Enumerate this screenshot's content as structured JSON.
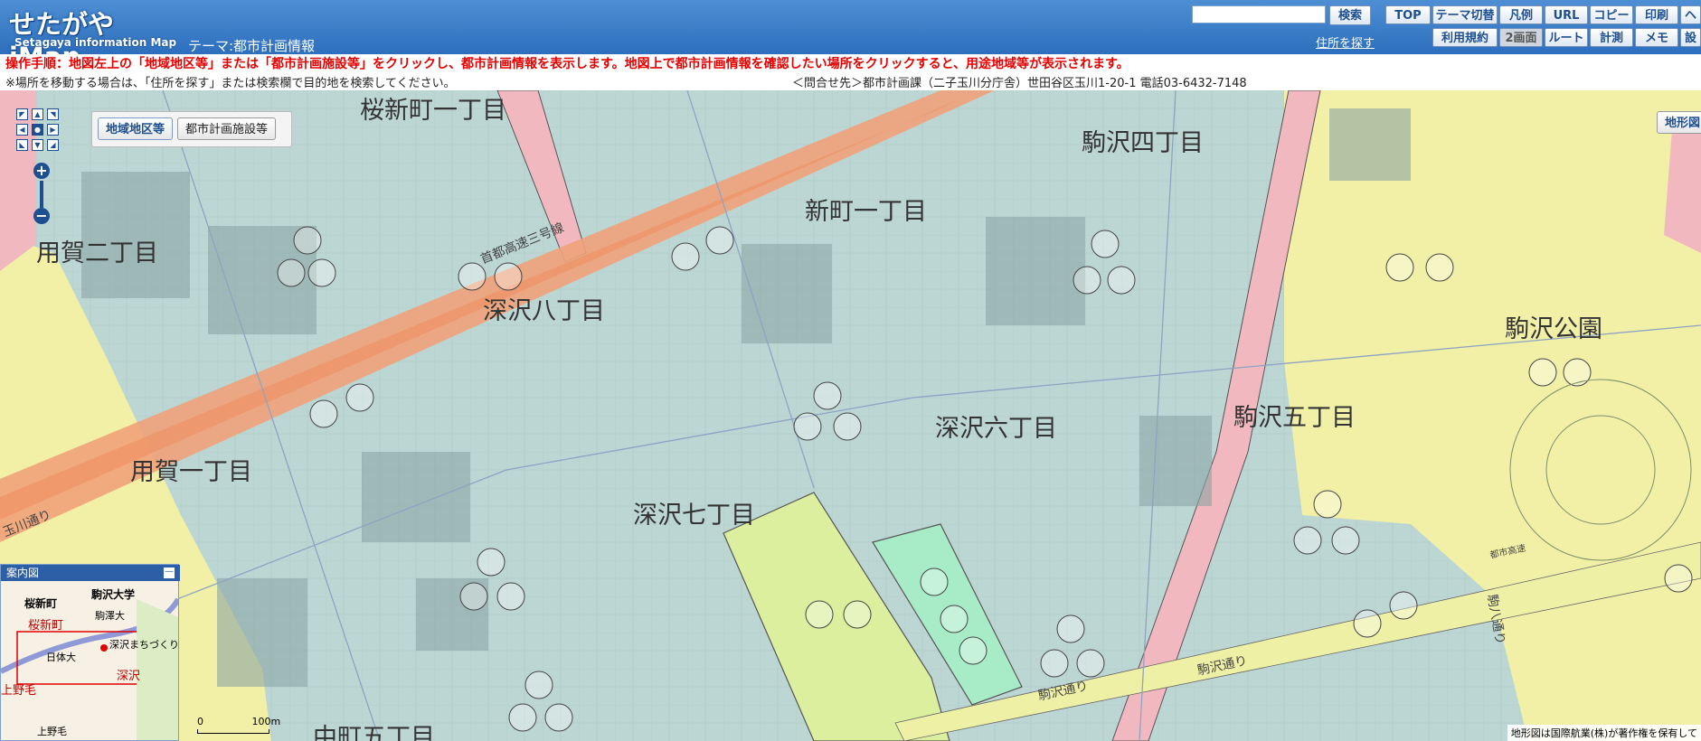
{
  "header": {
    "logo_main": "せたがやiMap",
    "logo_sub": "Setagaya information Map",
    "theme": "テーマ:都市計画情報",
    "search_placeholder": "",
    "search_button": "検索",
    "address_link": "住所を探す",
    "buttons_row1": [
      "TOP",
      "テーマ切替",
      "凡例",
      "URL",
      "コピー",
      "印刷",
      "ヘ"
    ],
    "buttons_row2": [
      "利用規約",
      "2画面",
      "ルート",
      "計測",
      "メモ",
      "設"
    ]
  },
  "instructions": {
    "line1": "操作手順：地図左上の「地域地区等」または「都市計画施設等」をクリックし、都市計画情報を表示します。地図上で都市計画情報を確認したい場所をクリックすると、用途地域等が表示されます。",
    "line2": "※場所を移動する場合は、「住所を探す」または検索欄で目的地を検索してください。",
    "contact": "＜問合せ先＞都市計画課（二子玉川分庁舎）世田谷区玉川1-20-1 電話03-6432-7148"
  },
  "map": {
    "layer_tabs": [
      "地域地区等",
      "都市計画施設等"
    ],
    "chikei_button": "地形図",
    "districts": [
      "桜新町一丁目",
      "駒沢四丁目",
      "新町一丁目",
      "用賀二丁目",
      "深沢八丁目",
      "駒沢公園",
      "深沢六丁目",
      "駒沢五丁目",
      "用賀一丁目",
      "深沢七丁目",
      "中町五丁目"
    ],
    "roads": [
      "首都高速三号線",
      "玉川通り",
      "駒沢通り",
      "駒沢通り",
      "駒八通り",
      "都市高速"
    ],
    "scale_labels": [
      "0",
      "100m"
    ],
    "copyright": "地形図は国際航業(株)が著作権を保有して"
  },
  "guide_map": {
    "title": "案内図",
    "labels": [
      "桜新町",
      "駒沢大学",
      "桜新町",
      "駒澤大",
      "深沢まちづくり",
      "日体大",
      "深沢",
      "上野毛",
      "上野毛"
    ]
  },
  "colors": {
    "header": "#3a7bc8",
    "residential": "#bcd6d4",
    "commercial_pink": "#f2b8bf",
    "yellow": "#f2f0a6",
    "yellow_green": "#dcef9e",
    "green": "#a8ecc7",
    "expressway": "#f0a27a",
    "alert_text": "#e60000"
  }
}
